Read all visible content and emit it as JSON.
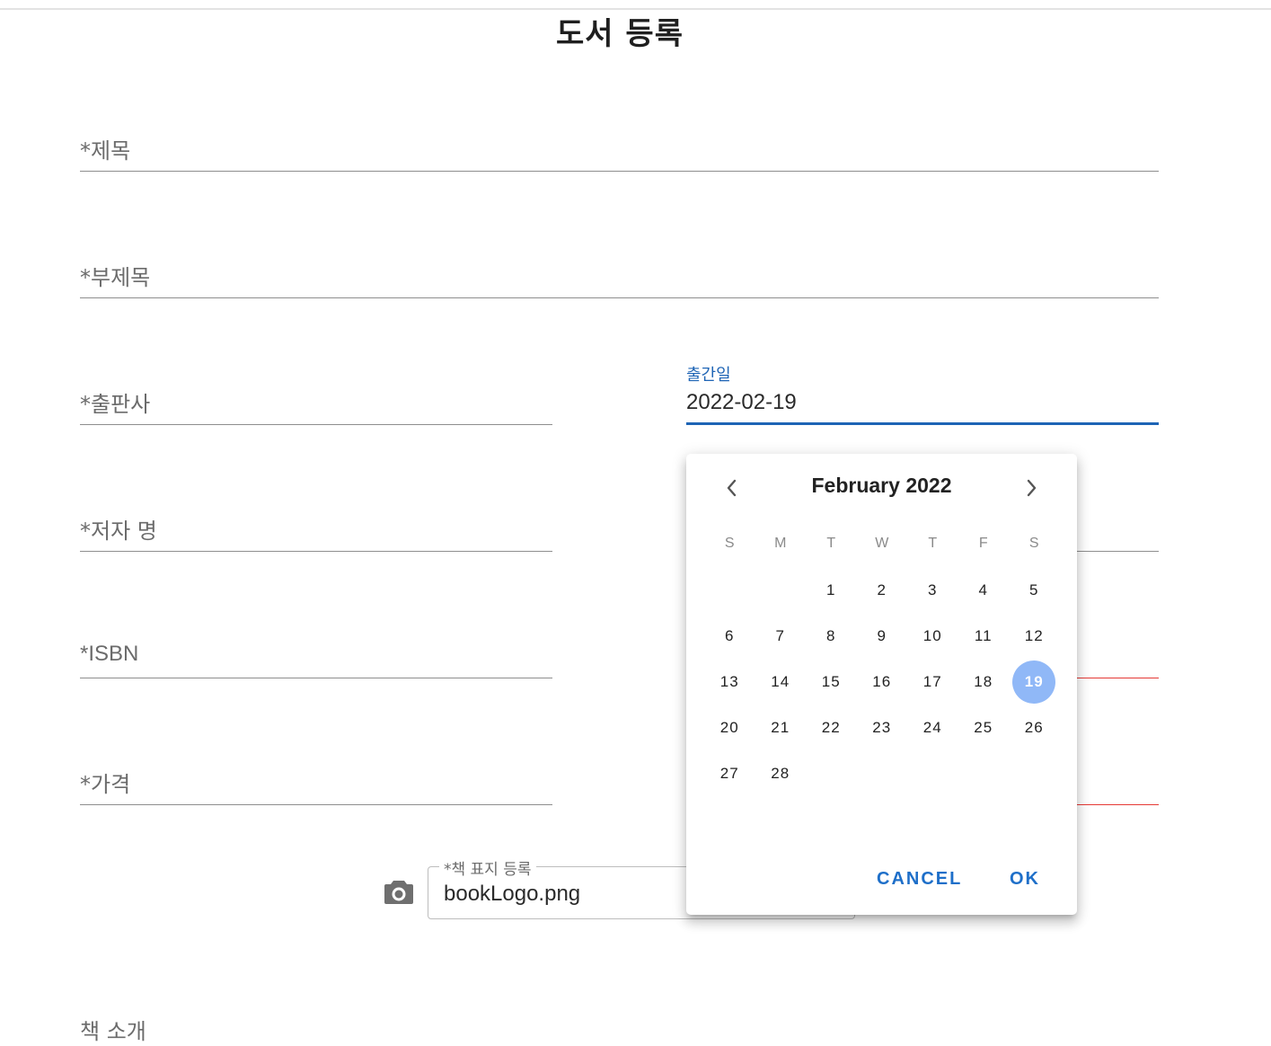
{
  "page": {
    "title": "도서 등록"
  },
  "form": {
    "title_label": "*제목",
    "subtitle_label": "*부제목",
    "publisher_label": "*출판사",
    "author_label": "*저자 명",
    "isbn_label": "*ISBN",
    "price_label": "*가격",
    "pubdate": {
      "label": "출간일",
      "value": "2022-02-19"
    },
    "cover": {
      "label": "*책 표지 등록",
      "value": "bookLogo.png",
      "icon": "camera-icon"
    },
    "intro_label": "책 소개"
  },
  "datepicker": {
    "month_label": "February 2022",
    "weekdays": [
      "S",
      "M",
      "T",
      "W",
      "T",
      "F",
      "S"
    ],
    "weeks": [
      [
        "",
        "",
        "1",
        "2",
        "3",
        "4",
        "5"
      ],
      [
        "6",
        "7",
        "8",
        "9",
        "10",
        "11",
        "12"
      ],
      [
        "13",
        "14",
        "15",
        "16",
        "17",
        "18",
        "19"
      ],
      [
        "20",
        "21",
        "22",
        "23",
        "24",
        "25",
        "26"
      ],
      [
        "27",
        "28",
        "",
        "",
        "",
        "",
        ""
      ]
    ],
    "selected_day": "19",
    "cancel_label": "CANCEL",
    "ok_label": "OK",
    "accent_color": "#1e64b5",
    "selected_color": "#90b8f7"
  }
}
